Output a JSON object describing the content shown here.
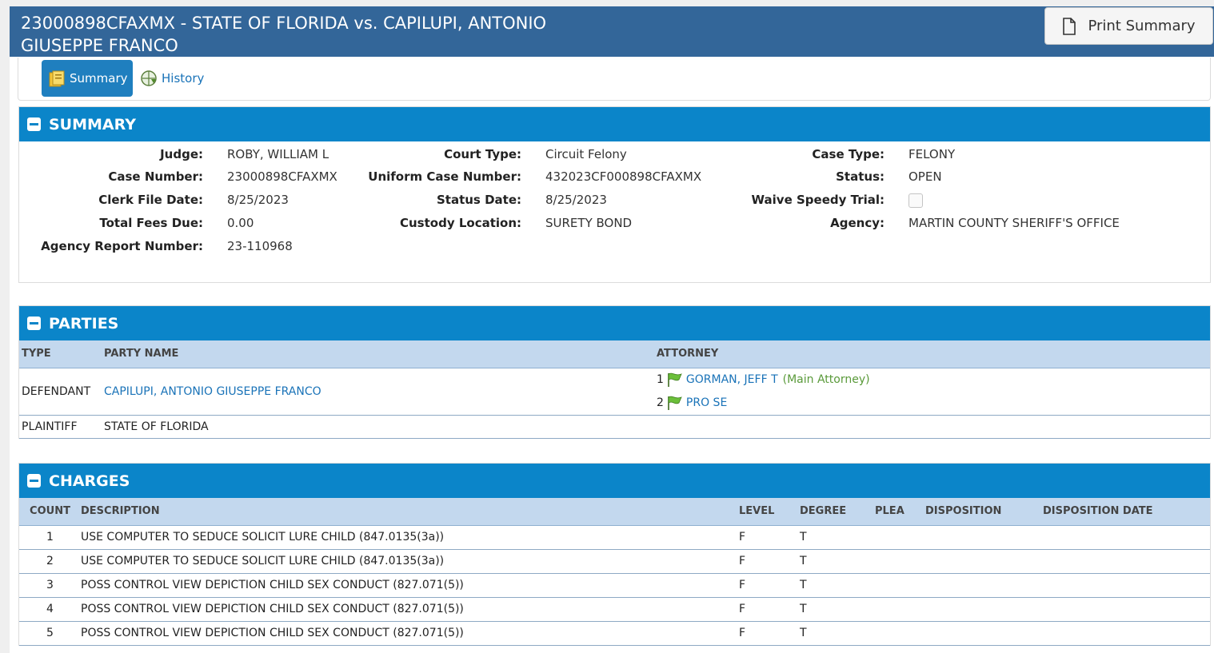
{
  "header": {
    "title": "23000898CFAXMX - STATE OF FLORIDA vs. CAPILUPI, ANTONIO GIUSEPPE FRANCO",
    "print_label": "Print Summary"
  },
  "tabs": {
    "summary": "Summary",
    "history": "History"
  },
  "summary": {
    "heading": "SUMMARY",
    "fields": {
      "judge_label": "Judge:",
      "judge": "ROBY, WILLIAM L",
      "case_number_label": "Case Number:",
      "case_number": "23000898CFAXMX",
      "clerk_file_date_label": "Clerk File Date:",
      "clerk_file_date": "8/25/2023",
      "total_fees_label": "Total Fees Due:",
      "total_fees": "0.00",
      "agency_report_label": "Agency Report Number:",
      "agency_report": "23-110968",
      "court_type_label": "Court Type:",
      "court_type": "Circuit Felony",
      "uniform_case_label": "Uniform Case Number:",
      "uniform_case": "432023CF000898CFAXMX",
      "status_date_label": "Status Date:",
      "status_date": "8/25/2023",
      "custody_label": "Custody Location:",
      "custody": "SURETY BOND",
      "case_type_label": "Case Type:",
      "case_type": "FELONY",
      "status_label": "Status:",
      "status": "OPEN",
      "speedy_label": "Waive Speedy Trial:",
      "speedy_checked": false,
      "agency_label": "Agency:",
      "agency": "MARTIN COUNTY SHERIFF'S OFFICE"
    }
  },
  "parties": {
    "heading": "PARTIES",
    "columns": [
      "TYPE",
      "PARTY NAME",
      "ATTORNEY"
    ],
    "rows": [
      {
        "type": "DEFENDANT",
        "name": "CAPILUPI, ANTONIO GIUSEPPE FRANCO",
        "attorneys": [
          {
            "num": "1",
            "name": "GORMAN, JEFF T",
            "note": "(Main Attorney)"
          },
          {
            "num": "2",
            "name": "PRO SE",
            "note": ""
          }
        ]
      },
      {
        "type": "PLAINTIFF",
        "name": "STATE OF FLORIDA",
        "attorneys": []
      }
    ]
  },
  "charges": {
    "heading": "CHARGES",
    "columns": [
      "COUNT",
      "DESCRIPTION",
      "LEVEL",
      "DEGREE",
      "PLEA",
      "DISPOSITION",
      "DISPOSITION DATE"
    ],
    "rows": [
      {
        "count": "1",
        "description": "USE COMPUTER TO SEDUCE SOLICIT LURE CHILD (847.0135(3a))",
        "level": "F",
        "degree": "T",
        "plea": "",
        "disposition": "",
        "disposition_date": ""
      },
      {
        "count": "2",
        "description": "USE COMPUTER TO SEDUCE SOLICIT LURE CHILD (847.0135(3a))",
        "level": "F",
        "degree": "T",
        "plea": "",
        "disposition": "",
        "disposition_date": ""
      },
      {
        "count": "3",
        "description": "POSS CONTROL VIEW DEPICTION CHILD SEX CONDUCT (827.071(5))",
        "level": "F",
        "degree": "T",
        "plea": "",
        "disposition": "",
        "disposition_date": ""
      },
      {
        "count": "4",
        "description": "POSS CONTROL VIEW DEPICTION CHILD SEX CONDUCT (827.071(5))",
        "level": "F",
        "degree": "T",
        "plea": "",
        "disposition": "",
        "disposition_date": ""
      },
      {
        "count": "5",
        "description": "POSS CONTROL VIEW DEPICTION CHILD SEX CONDUCT (827.071(5))",
        "level": "F",
        "degree": "T",
        "plea": "",
        "disposition": "",
        "disposition_date": ""
      }
    ]
  },
  "colors": {
    "header_bg": "#336699",
    "panel_head_bg": "#0b85c9",
    "active_tab_bg": "#1f7fbf",
    "table_head_bg": "#c3d8ee",
    "link": "#1a73b8",
    "main_attorney_note": "#5a9a3a"
  },
  "icons": {
    "print": "document-icon",
    "summary_tab": "folder-icon",
    "history_tab": "globe-history-icon",
    "attorney": "green-flag-icon",
    "collapse": "minus-icon"
  }
}
